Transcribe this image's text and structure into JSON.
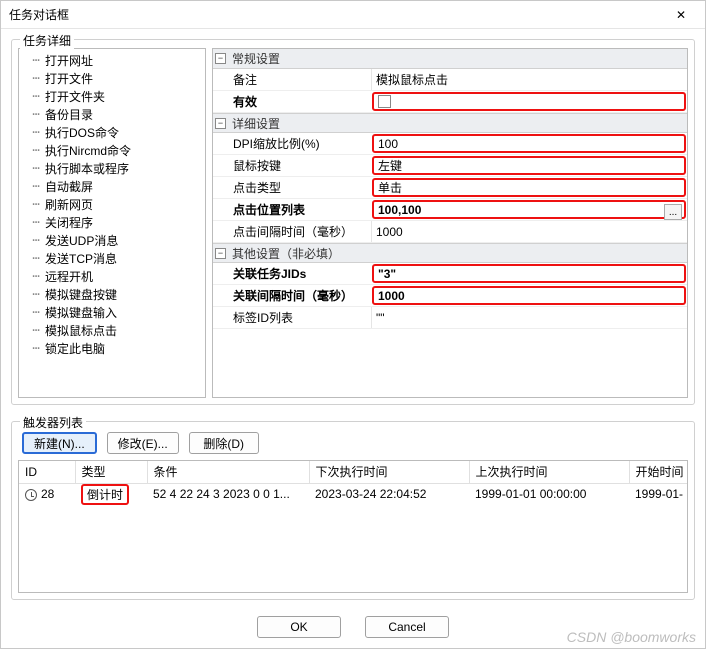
{
  "window": {
    "title": "任务对话框",
    "detailsLegend": "任务详细",
    "triggersLegend": "触发器列表"
  },
  "tree": {
    "items": [
      "打开网址",
      "打开文件",
      "打开文件夹",
      "备份目录",
      "执行DOS命令",
      "执行Nircmd命令",
      "执行脚本或程序",
      "自动截屏",
      "刷新网页",
      "关闭程序",
      "发送UDP消息",
      "发送TCP消息",
      "远程开机",
      "模拟键盘按键",
      "模拟键盘输入",
      "模拟鼠标点击",
      "锁定此电脑"
    ]
  },
  "propGroups": {
    "g1": {
      "title": "常规设置",
      "remarkLabel": "备注",
      "remarkValue": "模拟鼠标点击",
      "enabledLabel": "有效"
    },
    "g2": {
      "title": "详细设置",
      "dpiLabel": "DPI缩放比例(%)",
      "dpiValue": "100",
      "btnLabel": "鼠标按键",
      "btnValue": "左键",
      "typeLabel": "点击类型",
      "typeValue": "单击",
      "posLabel": "点击位置列表",
      "posValue": "100,100",
      "intvLabel": "点击间隔时间（毫秒）",
      "intvValue": "1000"
    },
    "g3": {
      "title": "其他设置（非必填）",
      "jidsLabel": "关联任务JIDs",
      "jidsValue": "\"3\"",
      "gapLabel": "关联间隔时间（毫秒）",
      "gapValue": "1000",
      "tabidsLabel": "标签ID列表",
      "tabidsValue": "\"\""
    }
  },
  "triggerButtons": {
    "new": "新建(N)...",
    "edit": "修改(E)...",
    "del": "删除(D)"
  },
  "triggerTable": {
    "headers": {
      "id": "ID",
      "type": "类型",
      "cond": "条件",
      "next": "下次执行时间",
      "last": "上次执行时间",
      "start": "开始时间"
    },
    "row": {
      "id": "28",
      "type": "倒计时",
      "cond": "52 4 22 24 3 2023 0 0 1...",
      "next": "2023-03-24 22:04:52",
      "last": "1999-01-01 00:00:00",
      "start": "1999-01-"
    }
  },
  "footer": {
    "ok": "OK",
    "cancel": "Cancel"
  },
  "watermark": "CSDN @boomworks",
  "icons": {
    "minus": "−",
    "ellipsis": "...",
    "close": "✕"
  }
}
